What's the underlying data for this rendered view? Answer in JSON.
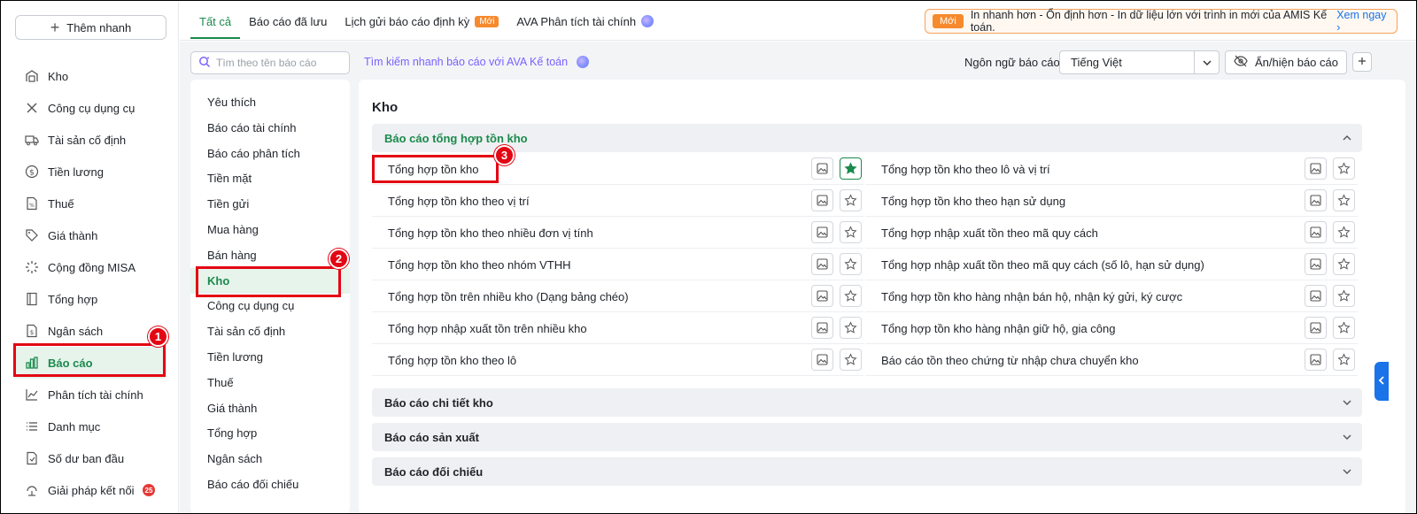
{
  "sidebar": {
    "add_label": "Thêm nhanh",
    "items": [
      {
        "label": "Kho",
        "icon": "warehouse-icon",
        "active": false
      },
      {
        "label": "Công cụ dụng cụ",
        "icon": "tools-icon",
        "active": false
      },
      {
        "label": "Tài sản cố định",
        "icon": "truck-icon",
        "active": false
      },
      {
        "label": "Tiền lương",
        "icon": "dollar-icon",
        "active": false
      },
      {
        "label": "Thuế",
        "icon": "tax-document-icon",
        "active": false
      },
      {
        "label": "Giá thành",
        "icon": "price-tag-icon",
        "active": false
      },
      {
        "label": "Cộng đồng MISA",
        "icon": "community-icon",
        "active": false
      },
      {
        "label": "Tổng hợp",
        "icon": "summary-icon",
        "active": false
      },
      {
        "label": "Ngân sách",
        "icon": "budget-icon",
        "active": false
      },
      {
        "label": "Báo cáo",
        "icon": "bar-chart-icon",
        "active": true
      },
      {
        "label": "Phân tích tài chính",
        "icon": "analytics-icon",
        "active": false
      },
      {
        "label": "Danh mục",
        "icon": "list-icon",
        "active": false
      },
      {
        "label": "Số dư ban đầu",
        "icon": "opening-balance-icon",
        "active": false
      },
      {
        "label": "Giải pháp kết nối",
        "icon": "connect-icon",
        "active": false,
        "badge": "25"
      }
    ]
  },
  "tabs": [
    {
      "label": "Tất cả",
      "active": true
    },
    {
      "label": "Báo cáo đã lưu",
      "active": false
    },
    {
      "label": "Lịch gửi báo cáo định kỳ",
      "active": false,
      "tag": "Mới"
    },
    {
      "label": "AVA Phân tích tài chính",
      "active": false
    }
  ],
  "banner": {
    "tag": "Mới",
    "text": "In nhanh hơn - Ổn định hơn - In dữ liệu lớn với trình in mới của AMIS Kế toán.",
    "link": "Xem ngay"
  },
  "toolbar": {
    "search_placeholder": "Tìm theo tên báo cáo",
    "ava_search": "Tìm kiếm nhanh báo cáo với AVA Kế toán",
    "lang_label": "Ngôn ngữ báo cáo",
    "lang_value": "Tiếng Việt",
    "toggle_label": "Ẩn/hiện báo cáo"
  },
  "categories": [
    {
      "label": "Yêu thích",
      "active": false
    },
    {
      "label": "Báo cáo tài chính",
      "active": false
    },
    {
      "label": "Báo cáo phân tích",
      "active": false
    },
    {
      "label": "Tiền mặt",
      "active": false
    },
    {
      "label": "Tiền gửi",
      "active": false
    },
    {
      "label": "Mua hàng",
      "active": false
    },
    {
      "label": "Bán hàng",
      "active": false
    },
    {
      "label": "Kho",
      "active": true
    },
    {
      "label": "Công cụ dụng cụ",
      "active": false
    },
    {
      "label": "Tài sản cố định",
      "active": false
    },
    {
      "label": "Tiền lương",
      "active": false
    },
    {
      "label": "Thuế",
      "active": false
    },
    {
      "label": "Giá thành",
      "active": false
    },
    {
      "label": "Tổng hợp",
      "active": false
    },
    {
      "label": "Ngân sách",
      "active": false
    },
    {
      "label": "Báo cáo đối chiếu",
      "active": false
    }
  ],
  "main": {
    "title": "Kho",
    "groups": [
      {
        "label": "Báo cáo tổng hợp tồn kho",
        "open": true
      },
      {
        "label": "Báo cáo chi tiết kho",
        "open": false
      },
      {
        "label": "Báo cáo sản xuất",
        "open": false
      },
      {
        "label": "Báo cáo đối chiếu",
        "open": false
      }
    ],
    "reports_left": [
      {
        "name": "Tổng hợp tồn kho",
        "favorite": true
      },
      {
        "name": "Tổng hợp tồn kho theo vị trí",
        "favorite": false
      },
      {
        "name": "Tổng hợp tồn kho theo nhiều đơn vị tính",
        "favorite": false
      },
      {
        "name": "Tổng hợp tồn kho theo nhóm VTHH",
        "favorite": false
      },
      {
        "name": "Tổng hợp tồn trên nhiều kho (Dạng bảng chéo)",
        "favorite": false
      },
      {
        "name": "Tổng hợp nhập xuất tồn trên nhiều kho",
        "favorite": false
      },
      {
        "name": "Tổng hợp tồn kho theo lô",
        "favorite": false
      }
    ],
    "reports_right": [
      {
        "name": "Tổng hợp tồn kho theo lô và vị trí",
        "favorite": false
      },
      {
        "name": "Tổng hợp tồn kho theo hạn sử dụng",
        "favorite": false
      },
      {
        "name": "Tổng hợp nhập xuất tồn theo mã quy cách",
        "favorite": false
      },
      {
        "name": "Tổng hợp nhập xuất tồn theo mã quy cách (số lô, hạn sử dụng)",
        "favorite": false
      },
      {
        "name": "Tổng hợp tồn kho hàng nhận bán hộ, nhận ký gửi, ký cược",
        "favorite": false
      },
      {
        "name": "Tổng hợp tồn kho hàng nhận giữ hộ, gia công",
        "favorite": false
      },
      {
        "name": "Báo cáo tồn theo chứng từ nhập chưa chuyển kho",
        "favorite": false
      }
    ]
  },
  "annotations": [
    "1",
    "2",
    "3"
  ],
  "colors": {
    "accent": "#1b8a4c",
    "highlight": "#e30613",
    "new_tag": "#f68a2d",
    "link": "#1a73e8",
    "ava": "#7b61ff"
  }
}
